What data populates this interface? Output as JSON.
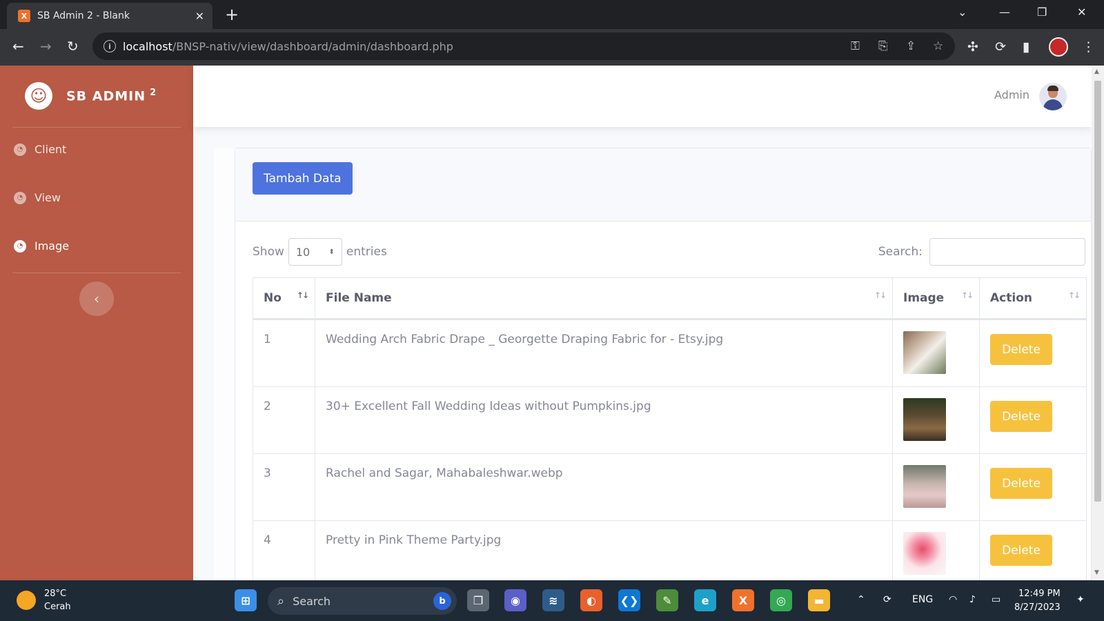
{
  "browser": {
    "tab_title": "SB Admin 2 - Blank",
    "tab_favicon": "XAMPP",
    "url_host": "localhost",
    "url_path": "/BNSP-nativ/view/dashboard/admin/dashboard.php"
  },
  "sidebar": {
    "brand": "SB ADMIN",
    "brand_sup": "2",
    "items": [
      {
        "label": "Client",
        "icon": "tachometer-icon"
      },
      {
        "label": "View",
        "icon": "tachometer-icon"
      },
      {
        "label": "Image",
        "icon": "tachometer-icon"
      }
    ],
    "toggle_glyph": "‹",
    "color": "#b85a45"
  },
  "topbar": {
    "user_name": "Admin"
  },
  "card": {
    "add_button": "Tambah Data",
    "show_label": "Show",
    "entries_value": "10",
    "entries_label": "entries",
    "search_label": "Search:"
  },
  "table": {
    "columns": [
      "No",
      "File Name",
      "Image",
      "Action"
    ],
    "rows": [
      {
        "no": "1",
        "file": "Wedding Arch Fabric Drape _ Georgette Draping Fabric for - Etsy.jpg",
        "action": "Delete"
      },
      {
        "no": "2",
        "file": "30+ Excellent Fall Wedding Ideas without Pumpkins.jpg",
        "action": "Delete"
      },
      {
        "no": "3",
        "file": "Rachel and Sagar, Mahabaleshwar.webp",
        "action": "Delete"
      },
      {
        "no": "4",
        "file": "Pretty in Pink Theme Party.jpg",
        "action": "Delete"
      }
    ]
  },
  "taskbar": {
    "temp": "28°C",
    "condition": "Cerah",
    "search": "Search",
    "lang": "ENG",
    "time": "12:49 PM",
    "date": "8/27/2023"
  },
  "colors": {
    "primary": "#4e73df",
    "warning": "#f6c23e",
    "sidebar": "#b85a45"
  }
}
